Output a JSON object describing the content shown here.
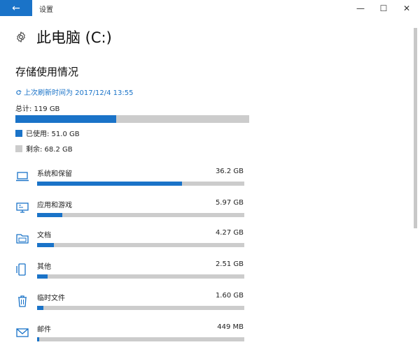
{
  "window": {
    "title": "设置",
    "back_icon": "←",
    "minimize_icon": "—",
    "maximize_icon": "☐",
    "close_icon": "✕"
  },
  "header": {
    "title": "此电脑 (C:)",
    "icon": "gear-icon"
  },
  "storage": {
    "section_title": "存储使用情况",
    "refresh_text": "上次刷新时间为 2017/12/4 13:55",
    "total_text": "总计: 119 GB",
    "used_fraction": 0.43,
    "used_text": "已使用: 51.0 GB",
    "free_text": "剩余: 68.2 GB",
    "accent_color": "#1a73c8",
    "track_color": "#cccccc"
  },
  "categories": [
    {
      "label": "系统和保留",
      "size": "36.2 GB",
      "fraction": 0.7,
      "icon": "laptop-icon"
    },
    {
      "label": "应用和游戏",
      "size": "5.97 GB",
      "fraction": 0.12,
      "icon": "monitor-icon"
    },
    {
      "label": "文档",
      "size": "4.27 GB",
      "fraction": 0.08,
      "icon": "folder-icon"
    },
    {
      "label": "其他",
      "size": "2.51 GB",
      "fraction": 0.05,
      "icon": "phone-icon"
    },
    {
      "label": "临时文件",
      "size": "1.60 GB",
      "fraction": 0.03,
      "icon": "trash-icon"
    },
    {
      "label": "邮件",
      "size": "449 MB",
      "fraction": 0.01,
      "icon": "mail-icon"
    }
  ]
}
